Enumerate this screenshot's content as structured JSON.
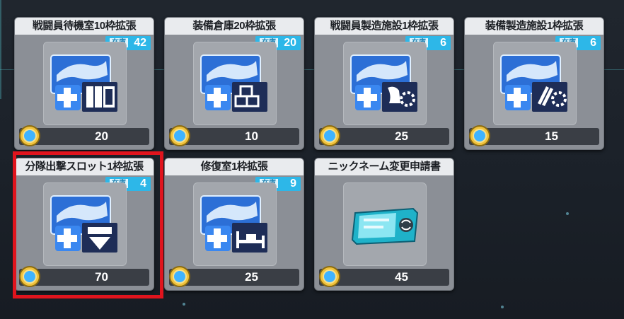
{
  "stock_label": "在庫",
  "items": [
    {
      "title": "戦闘員待機室10枠拡張",
      "stock": "42",
      "price": "20",
      "icon": "room-expand-icon"
    },
    {
      "title": "装備倉庫20枠拡張",
      "stock": "20",
      "price": "10",
      "icon": "warehouse-expand-icon"
    },
    {
      "title": "戦闘員製造施設1枠拡張",
      "stock": "6",
      "price": "25",
      "icon": "unit-factory-expand-icon"
    },
    {
      "title": "装備製造施設1枠拡張",
      "stock": "6",
      "price": "15",
      "icon": "equip-factory-expand-icon"
    },
    {
      "title": "分隊出撃スロット1枠拡張",
      "stock": "4",
      "price": "70",
      "icon": "squad-slot-expand-icon"
    },
    {
      "title": "修復室1枠拡張",
      "stock": "9",
      "price": "25",
      "icon": "repair-room-expand-icon"
    },
    {
      "title": "ニックネーム変更申請書",
      "stock": "",
      "price": "45",
      "icon": "rename-ticket-icon"
    }
  ],
  "colors": {
    "accent": "#2db7e8",
    "highlight": "#e0141d"
  }
}
